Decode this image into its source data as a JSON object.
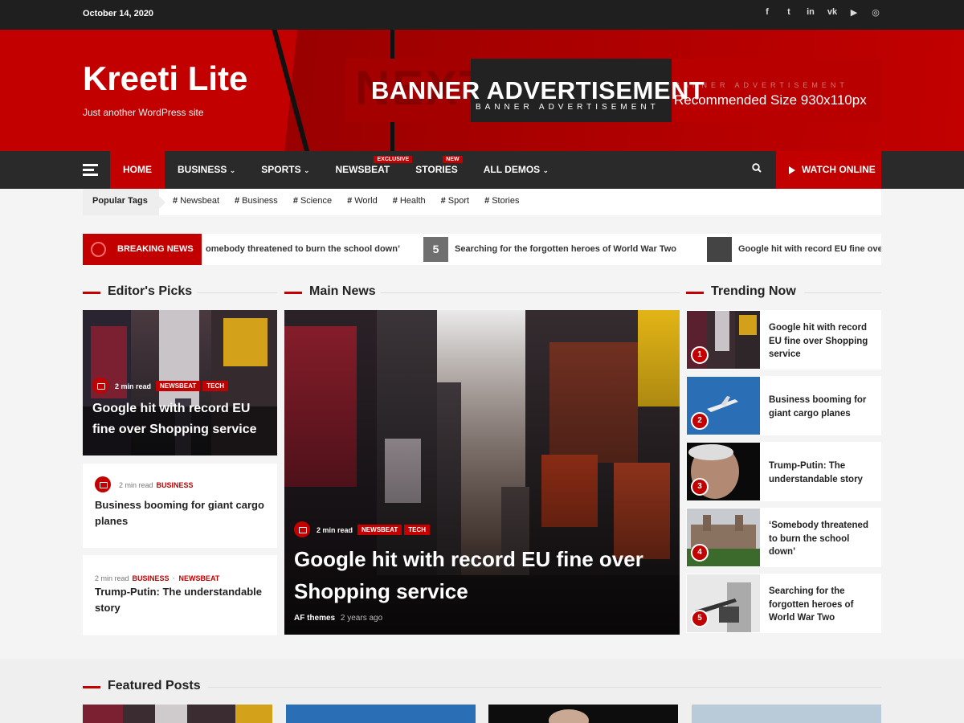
{
  "topbar": {
    "date": "October 14, 2020",
    "social": [
      {
        "name": "facebook-icon",
        "glyph": "f"
      },
      {
        "name": "twitter-icon",
        "glyph": "t"
      },
      {
        "name": "linkedin-icon",
        "glyph": "in"
      },
      {
        "name": "vk-icon",
        "glyph": "vk"
      },
      {
        "name": "youtube-icon",
        "glyph": "▶"
      },
      {
        "name": "instagram-icon",
        "glyph": "◎"
      }
    ]
  },
  "header": {
    "site_title": "Kreeti Lite",
    "site_desc": "Just another WordPress site",
    "banner": {
      "bg_text": "NEXT",
      "title": "BANNER ADVERTISEMENT",
      "sub": "BANNER ADVERTISEMENT",
      "sub2": "BANNER ADVERTISEMENT",
      "size": "Recommended Size 930x110px"
    }
  },
  "nav": {
    "items": [
      {
        "label": "HOME",
        "active": true
      },
      {
        "label": "BUSINESS",
        "caret": true
      },
      {
        "label": "SPORTS",
        "caret": true
      },
      {
        "label": "NEWSBEAT",
        "tag": "EXCLUSIVE"
      },
      {
        "label": "STORIES",
        "tag": "NEW"
      },
      {
        "label": "ALL DEMOS",
        "caret": true
      }
    ],
    "watch_label": "WATCH ONLINE"
  },
  "tags": {
    "label": "Popular Tags",
    "items": [
      "Newsbeat",
      "Business",
      "Science",
      "World",
      "Health",
      "Sport",
      "Stories"
    ]
  },
  "breaking": {
    "label": "BREAKING NEWS",
    "items": [
      {
        "text": "omebody threatened to burn the school down’"
      },
      {
        "num": "5",
        "text": "Searching for the forgotten heroes of World War Two"
      },
      {
        "text": "Google hit with record EU fine ove"
      }
    ]
  },
  "sections": {
    "editors_picks": "Editor's Picks",
    "main_news": "Main News",
    "trending": "Trending Now",
    "featured": "Featured Posts"
  },
  "editors": {
    "top": {
      "read": "2 min read",
      "cats": [
        "NEWSBEAT",
        "TECH"
      ],
      "title": "Google hit with record EU fine over Shopping service"
    },
    "second": {
      "read": "2 min read",
      "cat": "BUSINESS",
      "title": "Business booming for giant cargo planes"
    },
    "third": {
      "read": "2 min read",
      "cat1": "BUSINESS",
      "sep": "·",
      "cat2": "NEWSBEAT",
      "title": "Trump-Putin: The understandable story"
    }
  },
  "main": {
    "read": "2 min read",
    "cats": [
      "NEWSBEAT",
      "TECH"
    ],
    "title": "Google hit with record EU fine over Shopping service",
    "author": "AF themes",
    "time": "2 years ago"
  },
  "trending": [
    {
      "num": "1",
      "title": "Google hit with record EU fine over Shopping service"
    },
    {
      "num": "2",
      "title": "Business booming for giant cargo planes"
    },
    {
      "num": "3",
      "title": "Trump-Putin: The understandable story"
    },
    {
      "num": "4",
      "title": "‘Somebody threatened to burn the school down’"
    },
    {
      "num": "5",
      "title": "Searching for the forgotten heroes of World War Two"
    }
  ],
  "colors": {
    "accent": "#c20000",
    "dark": "#2a2a2a"
  }
}
